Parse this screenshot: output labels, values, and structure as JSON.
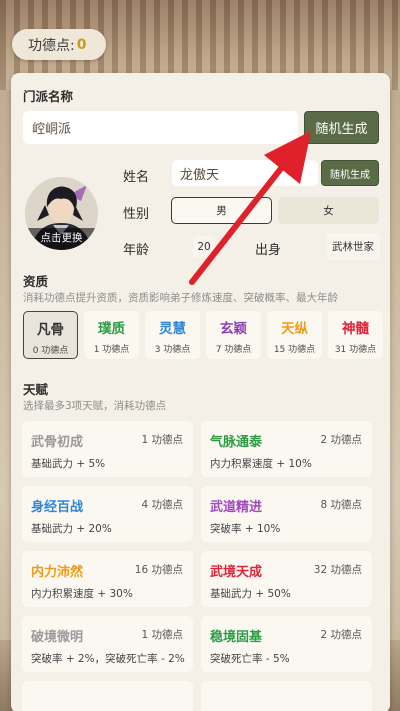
{
  "header": {
    "merit_label": "功德点:",
    "merit_value": "0"
  },
  "sect": {
    "title": "门派名称",
    "name_value": "崆峒派",
    "random_button": "随机生成"
  },
  "character": {
    "avatar_caption": "点击更换",
    "name_label": "姓名",
    "name_value": "龙傲天",
    "name_random_button": "随机生成",
    "gender_label": "性别",
    "gender_options": [
      "男",
      "女"
    ],
    "gender_selected": "男",
    "age_label": "年龄",
    "age_value": "20",
    "origin_label": "出身",
    "origin_value": "武林世家"
  },
  "aptitude": {
    "title": "资质",
    "subtitle": "消耗功德点提升资质，资质影响弟子修炼速度、突破概率、最大年龄",
    "options": [
      {
        "name": "凡骨",
        "cost": "0 功德点",
        "color": "#333333"
      },
      {
        "name": "璞质",
        "cost": "1 功德点",
        "color": "#2e9c45"
      },
      {
        "name": "灵慧",
        "cost": "3 功德点",
        "color": "#2d86d8"
      },
      {
        "name": "玄颖",
        "cost": "7 功德点",
        "color": "#8a3fb0"
      },
      {
        "name": "天纵",
        "cost": "15 功德点",
        "color": "#f29a18"
      },
      {
        "name": "神髓",
        "cost": "31 功德点",
        "color": "#e0243a"
      }
    ],
    "selected": "凡骨"
  },
  "talent": {
    "title": "天赋",
    "subtitle": "选择最多3项天赋，消耗功德点",
    "items": [
      {
        "name": "武骨初成",
        "cost": "1 功德点",
        "desc": "基础武力 + 5%",
        "color": "#9a9a9a"
      },
      {
        "name": "气脉通泰",
        "cost": "2 功德点",
        "desc": "内力积累速度 + 10%",
        "color": "#2e9c45"
      },
      {
        "name": "身经百战",
        "cost": "4 功德点",
        "desc": "基础武力 + 20%",
        "color": "#2d86d8"
      },
      {
        "name": "武道精进",
        "cost": "8 功德点",
        "desc": "突破率 + 10%",
        "color": "#a24bbf"
      },
      {
        "name": "内力沛然",
        "cost": "16 功德点",
        "desc": "内力积累速度 + 30%",
        "color": "#f29a18"
      },
      {
        "name": "武境天成",
        "cost": "32 功德点",
        "desc": "基础武力 + 50%",
        "color": "#e0243a"
      },
      {
        "name": "破境微明",
        "cost": "1 功德点",
        "desc": "突破率 + 2%，突破死亡率 - 2%",
        "color": "#9a9a9a"
      },
      {
        "name": "稳境固基",
        "cost": "2 功德点",
        "desc": "突破死亡率 - 5%",
        "color": "#2e9c45"
      }
    ]
  },
  "colors": {
    "accent_green": "#5a6b47",
    "merit_gold": "#c99a1e",
    "arrow_red": "#e0202a"
  }
}
